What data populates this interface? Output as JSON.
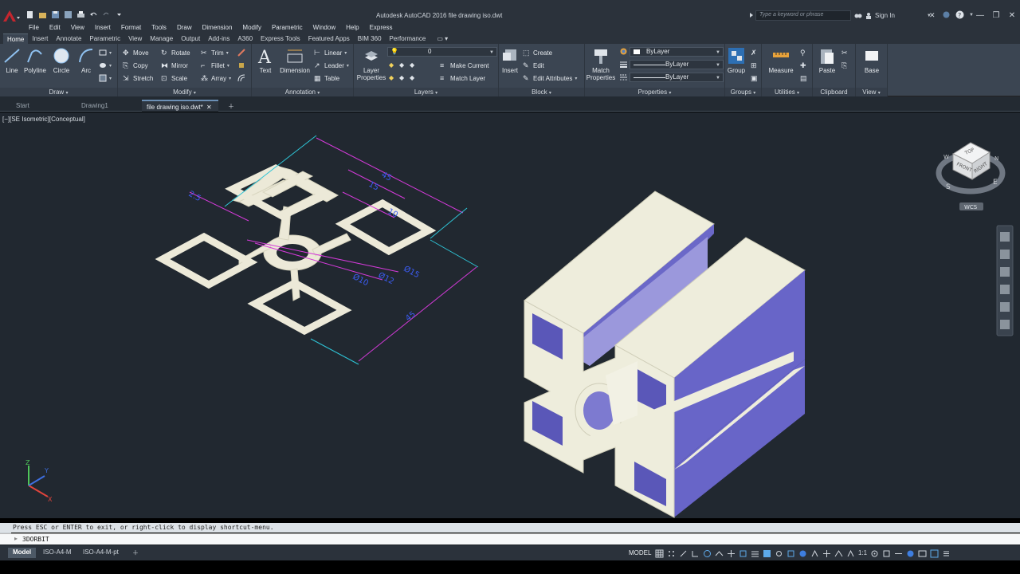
{
  "app": {
    "title": "Autodesk AutoCAD 2016    file drawing iso.dwt",
    "search_placeholder": "Type a keyword or phrase",
    "signin": "Sign In"
  },
  "menu": [
    "File",
    "Edit",
    "View",
    "Insert",
    "Format",
    "Tools",
    "Draw",
    "Dimension",
    "Modify",
    "Parametric",
    "Window",
    "Help",
    "Express"
  ],
  "ribbon_tabs": [
    "Home",
    "Insert",
    "Annotate",
    "Parametric",
    "View",
    "Manage",
    "Output",
    "Add-ins",
    "A360",
    "Express Tools",
    "Featured Apps",
    "BIM 360",
    "Performance"
  ],
  "ribbon": {
    "draw": {
      "title": "Draw",
      "line": "Line",
      "polyline": "Polyline",
      "circle": "Circle",
      "arc": "Arc"
    },
    "modify": {
      "title": "Modify",
      "move": "Move",
      "rotate": "Rotate",
      "trim": "Trim",
      "copy": "Copy",
      "mirror": "Mirror",
      "fillet": "Fillet",
      "stretch": "Stretch",
      "scale": "Scale",
      "array": "Array"
    },
    "annotation": {
      "title": "Annotation",
      "text": "Text",
      "dimension": "Dimension",
      "linear": "Linear",
      "leader": "Leader",
      "table": "Table"
    },
    "layers": {
      "title": "Layers",
      "layer_properties_1": "Layer",
      "layer_properties_2": "Properties",
      "current_layer": "0",
      "make_current": "Make Current",
      "match_layer": "Match Layer"
    },
    "block": {
      "title": "Block",
      "insert": "Insert",
      "create": "Create",
      "edit": "Edit",
      "edit_attributes": "Edit Attributes"
    },
    "properties": {
      "title": "Properties",
      "match_1": "Match",
      "match_2": "Properties",
      "color": "ByLayer",
      "linetype": "ByLayer",
      "lineweight": "ByLayer"
    },
    "groups": {
      "title": "Groups",
      "group": "Group"
    },
    "utilities": {
      "title": "Utilities",
      "measure": "Measure"
    },
    "clipboard": {
      "title": "Clipboard",
      "paste": "Paste"
    },
    "view": {
      "title": "View",
      "base": "Base"
    }
  },
  "file_tabs": [
    "Start",
    "Drawing1",
    "file drawing iso.dwt*"
  ],
  "viewport_label": "[−][SE Isometric][Conceptual]",
  "dimensions": {
    "d1": "45",
    "d2": "15",
    "d3": "10",
    "d4": "2.5",
    "d5": "Ø15",
    "d6": "Ø12",
    "d7": "Ø10",
    "d8": "45"
  },
  "viewcube": {
    "top": "TOP",
    "front": "FRONT",
    "right": "RIGHT",
    "wcs": "WCS",
    "n": "N",
    "s": "S",
    "e": "E",
    "w": "W"
  },
  "ucs": {
    "z": "Z",
    "y": "Y",
    "x": "X"
  },
  "command": {
    "history": "Press ESC or ENTER to exit, or right-click to display shortcut-menu.",
    "current": "3DORBIT"
  },
  "layout_tabs": [
    "Model",
    "ISO-A4-M",
    "ISO-A4-M-pt"
  ],
  "status": {
    "model": "MODEL",
    "scale": "1:1"
  }
}
